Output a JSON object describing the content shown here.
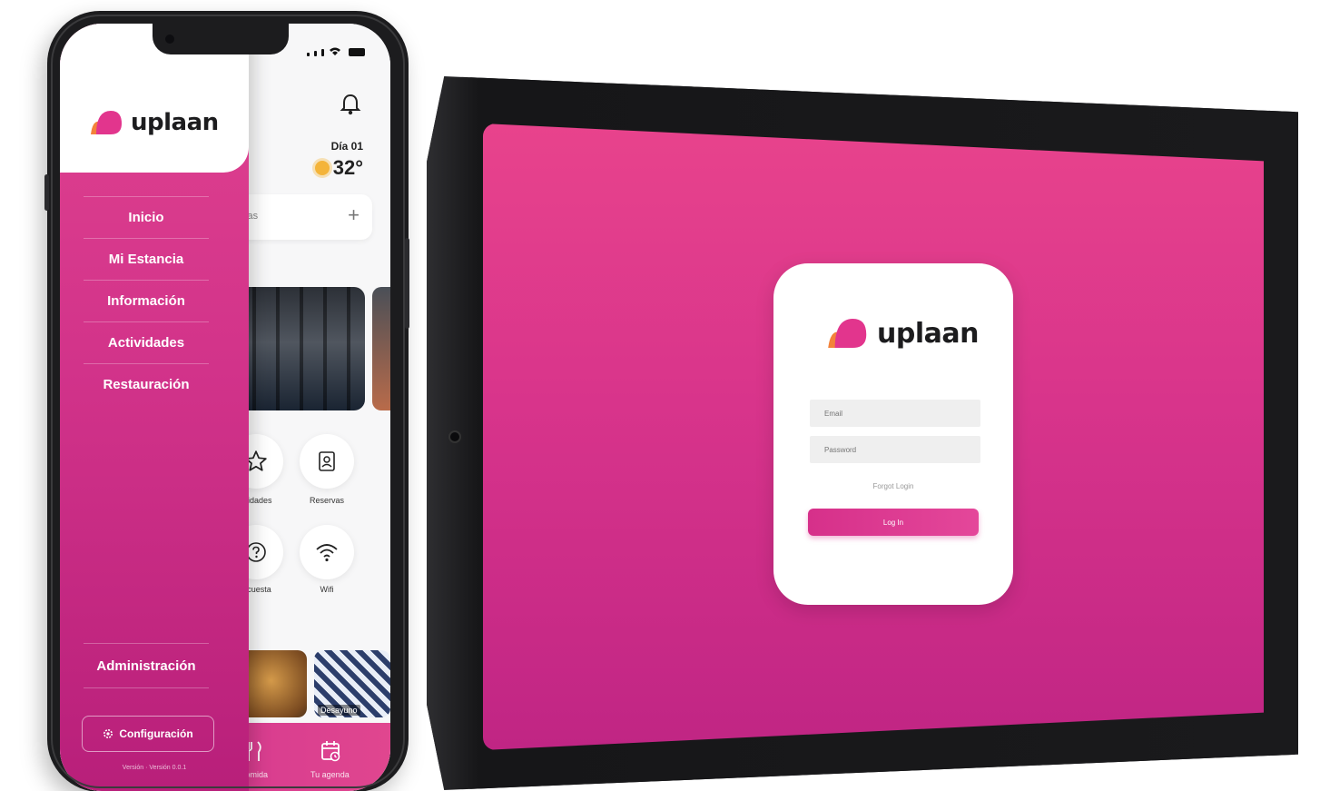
{
  "brand": {
    "name": "uplaan",
    "primary": "#d8348b",
    "accent_orange": "#f3823a"
  },
  "phone": {
    "status_icons": [
      "signal-icon",
      "wifi-icon",
      "battery-icon"
    ],
    "drawer": {
      "menu": [
        {
          "label": "Inicio"
        },
        {
          "label": "Mi Estancia"
        },
        {
          "label": "Información"
        },
        {
          "label": "Actividades"
        },
        {
          "label": "Restauración"
        }
      ],
      "admin_label": "Administración",
      "config_label": "Configuración",
      "version": "Versión · Versión 0.0.1"
    },
    "header": {
      "day": "Día 01",
      "temperature": "32°"
    },
    "search": {
      "placeholder": "idas",
      "add_icon": "plus-icon"
    },
    "shortcuts": [
      {
        "label": "ividades",
        "icon": "star-icon"
      },
      {
        "label": "Reservas",
        "icon": "badge-icon"
      },
      {
        "label": "ncuesta",
        "icon": "question-icon"
      },
      {
        "label": "Wifi",
        "icon": "wifi-icon"
      }
    ],
    "food_cards": [
      {
        "label": "Pe"
      },
      {
        "label": "Desayuno"
      }
    ],
    "bottom_nav": [
      {
        "label": "Comida",
        "icon": "cutlery-icon"
      },
      {
        "label": "Tu agenda",
        "icon": "calendar-icon"
      }
    ]
  },
  "tablet": {
    "login": {
      "email_placeholder": "Email",
      "password_placeholder": "Password",
      "forgot_label": "Forgot Login",
      "login_button": "Log In"
    }
  }
}
